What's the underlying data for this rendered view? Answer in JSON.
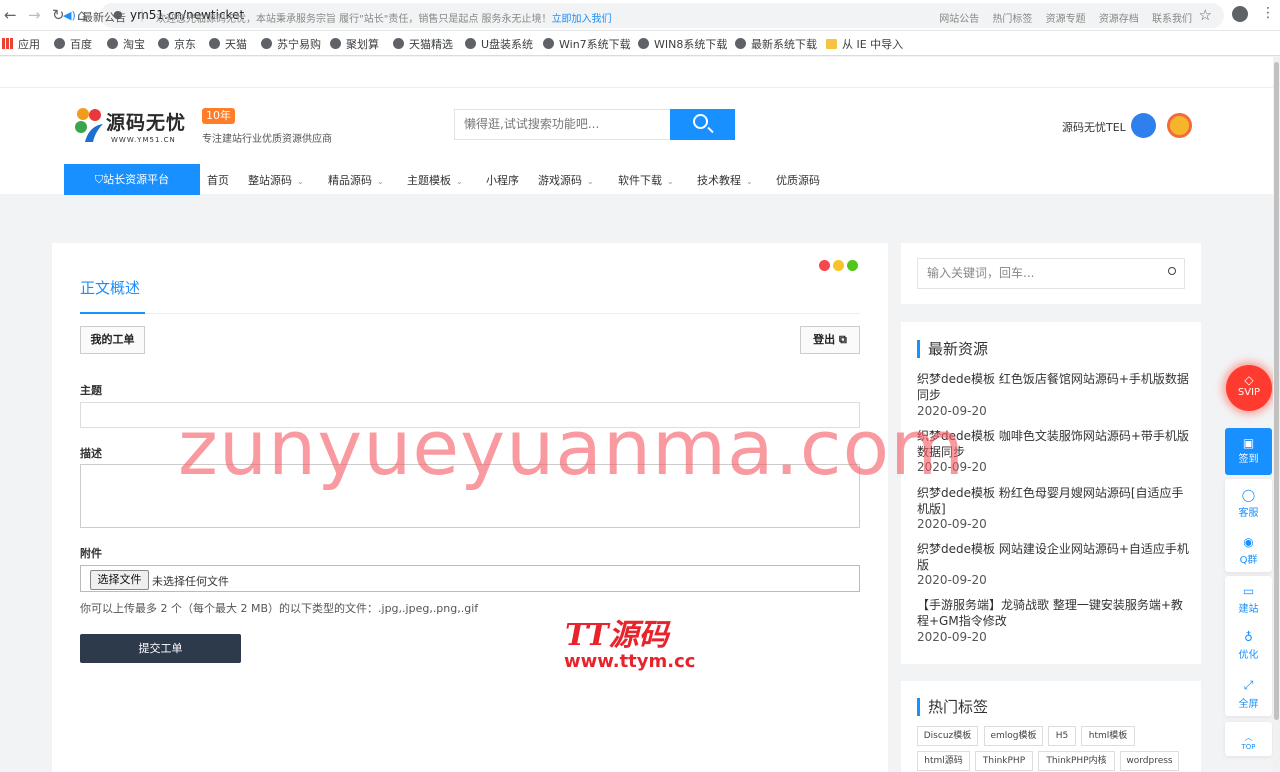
{
  "browser": {
    "url": "ym51.cn/newticket",
    "bookmarks": [
      "应用",
      "百度",
      "淘宝",
      "京东",
      "天猫",
      "苏宁易购",
      "聚划算",
      "天猫精选",
      "U盘装系统",
      "Win7系统下载",
      "WIN8系统下载",
      "最新系统下载",
      "从 IE 中导入"
    ]
  },
  "topbar": {
    "notice_label": "最新公告",
    "notice_text": "欢迎您光临源码无忧，本站秉承服务宗旨 履行\"站长\"责任，销售只是起点 服务永无止境！",
    "notice_link": "立即加入我们",
    "links": [
      "网站公告",
      "热门标签",
      "资源专题",
      "资源存档",
      "联系我们"
    ]
  },
  "header": {
    "logo_name": "源码无忧",
    "logo_domain": "WWW.YM51.CN",
    "badge": "10年",
    "slogan": "专注建站行业优质资源供应商",
    "search_placeholder": "懒得逛,试试搜索功能吧...",
    "tel_label": "源码无忧TEL"
  },
  "nav": {
    "primary": "站长资源平台",
    "items": [
      {
        "label": "首页",
        "dropdown": false
      },
      {
        "label": "整站源码",
        "dropdown": true
      },
      {
        "label": "精品源码",
        "dropdown": true
      },
      {
        "label": "主题模板",
        "dropdown": true
      },
      {
        "label": "小程序",
        "dropdown": false
      },
      {
        "label": "游戏源码",
        "dropdown": true
      },
      {
        "label": "软件下载",
        "dropdown": true
      },
      {
        "label": "技术教程",
        "dropdown": true
      },
      {
        "label": "优质源码",
        "dropdown": false
      }
    ]
  },
  "main": {
    "tab_title": "正文概述",
    "my_tickets": "我的工单",
    "logout": "登出",
    "subject_label": "主题",
    "desc_label": "描述",
    "attach_label": "附件",
    "file_button": "选择文件",
    "file_none": "未选择任何文件",
    "hint": "你可以上传最多 2 个（每个最大 2 MB）的以下类型的文件：.jpg,.jpeg,.png,.gif",
    "submit": "提交工单",
    "dot_colors": [
      "#f5484d",
      "#f7c22a",
      "#52c41a"
    ]
  },
  "sidebar": {
    "search_placeholder": "输入关键词，回车...",
    "new_title": "最新资源",
    "resources": [
      {
        "title": "织梦dede模板 红色饭店餐馆网站源码+手机版数据同步",
        "date": "2020-09-20"
      },
      {
        "title": "织梦dede模板 咖啡色文装服饰网站源码+带手机版数据同步",
        "date": "2020-09-20"
      },
      {
        "title": "织梦dede模板 粉红色母婴月嫂网站源码[自适应手机版]",
        "date": "2020-09-20"
      },
      {
        "title": "织梦dede模板 网站建设企业网站源码+自适应手机版",
        "date": "2020-09-20"
      },
      {
        "title": "【手游服务端】龙骑战歌 整理一键安装服务端+教程+GM指令修改",
        "date": "2020-09-20"
      }
    ],
    "tags_title": "热门标签",
    "tags": [
      "Discuz模板",
      "emlog模板",
      "H5",
      "html模板",
      "html源码",
      "ThinkPHP",
      "ThinkPHP内核",
      "wordpress"
    ]
  },
  "float": {
    "svip": "SVIP",
    "signin": "签到",
    "items": [
      "客服",
      "Q群",
      "建站",
      "优化",
      "全屏",
      "TOP"
    ]
  },
  "watermark": {
    "text": "zunyueyuanma.com",
    "brand": "TT源码",
    "brand_url": "www.ttym.cc"
  }
}
